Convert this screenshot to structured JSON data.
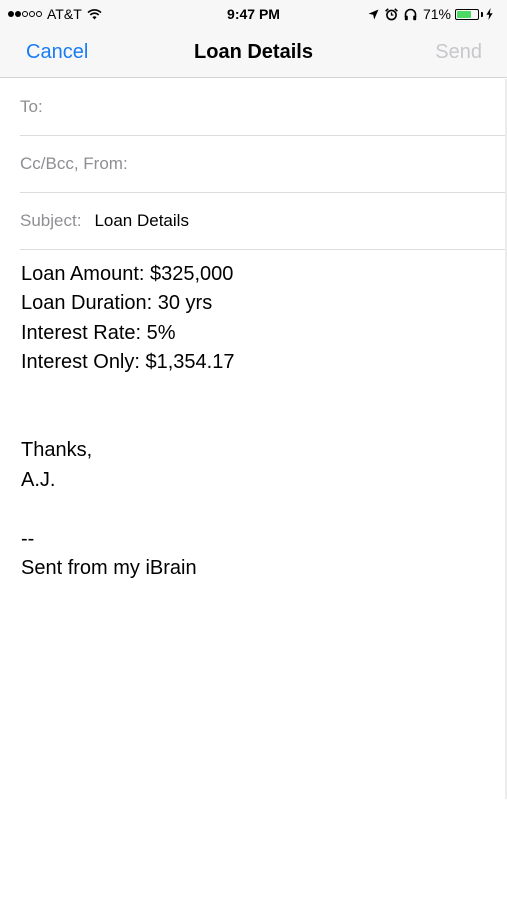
{
  "status_bar": {
    "carrier": "AT&T",
    "signal_bars_filled": 2,
    "signal_bars_total": 5,
    "time": "9:47 PM",
    "battery_percent": "71%",
    "battery_level": 0.71,
    "icons": [
      "wifi-icon",
      "location-arrow-icon",
      "alarm-clock-icon",
      "headphones-icon",
      "battery-icon",
      "charging-bolt-icon"
    ],
    "battery_color": "#4cd964"
  },
  "nav": {
    "cancel_label": "Cancel",
    "title": "Loan Details",
    "send_label": "Send",
    "accent_color": "#1a7cf5",
    "disabled_color": "#c7c7cc"
  },
  "fields": {
    "to_label": "To:",
    "to_value": "",
    "cc_label": "Cc/Bcc, From:",
    "subject_label": "Subject:",
    "subject_value": "Loan Details"
  },
  "body": {
    "lines": [
      "Loan Amount: $325,000",
      "Loan Duration: 30 yrs",
      "Interest Rate: 5%",
      "Interest Only: $1,354.17",
      "",
      "",
      "Thanks,",
      "A.J.",
      "",
      "--",
      "Sent from my iBrain"
    ]
  }
}
